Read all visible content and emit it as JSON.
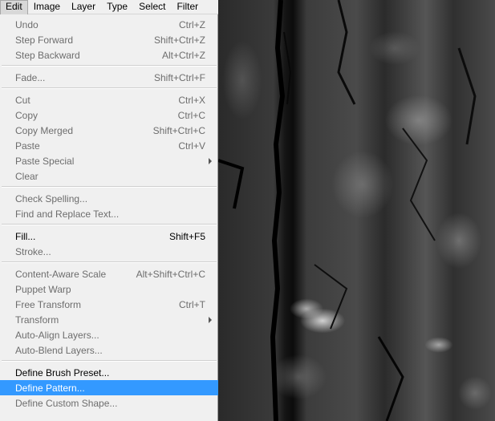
{
  "menubar": {
    "items": [
      {
        "label": "Edit",
        "active": true
      },
      {
        "label": "Image",
        "active": false
      },
      {
        "label": "Layer",
        "active": false
      },
      {
        "label": "Type",
        "active": false
      },
      {
        "label": "Select",
        "active": false
      },
      {
        "label": "Filter",
        "active": false
      }
    ]
  },
  "edit_menu": {
    "groups": [
      [
        {
          "label": "Undo",
          "shortcut": "Ctrl+Z",
          "enabled": false
        },
        {
          "label": "Step Forward",
          "shortcut": "Shift+Ctrl+Z",
          "enabled": false
        },
        {
          "label": "Step Backward",
          "shortcut": "Alt+Ctrl+Z",
          "enabled": false
        }
      ],
      [
        {
          "label": "Fade...",
          "shortcut": "Shift+Ctrl+F",
          "enabled": false
        }
      ],
      [
        {
          "label": "Cut",
          "shortcut": "Ctrl+X",
          "enabled": false
        },
        {
          "label": "Copy",
          "shortcut": "Ctrl+C",
          "enabled": false
        },
        {
          "label": "Copy Merged",
          "shortcut": "Shift+Ctrl+C",
          "enabled": false
        },
        {
          "label": "Paste",
          "shortcut": "Ctrl+V",
          "enabled": false
        },
        {
          "label": "Paste Special",
          "shortcut": "",
          "enabled": false,
          "submenu": true
        },
        {
          "label": "Clear",
          "shortcut": "",
          "enabled": false
        }
      ],
      [
        {
          "label": "Check Spelling...",
          "shortcut": "",
          "enabled": false
        },
        {
          "label": "Find and Replace Text...",
          "shortcut": "",
          "enabled": false
        }
      ],
      [
        {
          "label": "Fill...",
          "shortcut": "Shift+F5",
          "enabled": true
        },
        {
          "label": "Stroke...",
          "shortcut": "",
          "enabled": false
        }
      ],
      [
        {
          "label": "Content-Aware Scale",
          "shortcut": "Alt+Shift+Ctrl+C",
          "enabled": false
        },
        {
          "label": "Puppet Warp",
          "shortcut": "",
          "enabled": false
        },
        {
          "label": "Free Transform",
          "shortcut": "Ctrl+T",
          "enabled": false
        },
        {
          "label": "Transform",
          "shortcut": "",
          "enabled": false,
          "submenu": true
        },
        {
          "label": "Auto-Align Layers...",
          "shortcut": "",
          "enabled": false
        },
        {
          "label": "Auto-Blend Layers...",
          "shortcut": "",
          "enabled": false
        }
      ],
      [
        {
          "label": "Define Brush Preset...",
          "shortcut": "",
          "enabled": true
        },
        {
          "label": "Define Pattern...",
          "shortcut": "",
          "enabled": true,
          "highlighted": true
        },
        {
          "label": "Define Custom Shape...",
          "shortcut": "",
          "enabled": false
        }
      ]
    ]
  },
  "colors": {
    "menu_bg": "#f0f0f0",
    "highlight": "#3399ff",
    "disabled_text": "#6d6d6d"
  }
}
